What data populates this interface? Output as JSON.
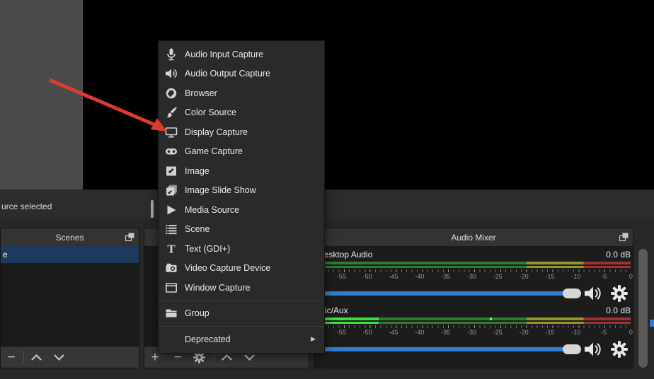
{
  "status_bar": {
    "text": "urce selected"
  },
  "menu": {
    "items": [
      {
        "label": "Audio Input Capture"
      },
      {
        "label": "Audio Output Capture"
      },
      {
        "label": "Browser"
      },
      {
        "label": "Color Source"
      },
      {
        "label": "Display Capture"
      },
      {
        "label": "Game Capture"
      },
      {
        "label": "Image"
      },
      {
        "label": "Image Slide Show"
      },
      {
        "label": "Media Source"
      },
      {
        "label": "Scene"
      },
      {
        "label": "Text (GDI+)"
      },
      {
        "label": "Video Capture Device"
      },
      {
        "label": "Window Capture"
      },
      {
        "label": "Group"
      },
      {
        "label": "Deprecated"
      }
    ],
    "submenu_arrow_glyph": "▶"
  },
  "scenes_panel": {
    "title": "Scenes",
    "selected_scene_label": "e"
  },
  "toolbar_glyphs": {
    "plus": "+",
    "minus": "−"
  },
  "audio_mixer": {
    "title": "Audio Mixer",
    "ticks": [
      "-55",
      "-50",
      "-45",
      "-40",
      "-35",
      "-30",
      "-25",
      "-20",
      "-15",
      "-10",
      "-5",
      "0"
    ],
    "channels": [
      {
        "name": "Desktop Audio",
        "volume_db": "0.0 dB",
        "level_db": -60,
        "peak_db": null
      },
      {
        "name": "Mic/Aux",
        "volume_db": "0.0 dB",
        "level_db": -48,
        "peak_db": -27
      }
    ]
  },
  "colors": {
    "accent_blue": "#2e7cd6",
    "selected_row_blue": "#1e3a5a",
    "meter_green_dim": "#2e7d2e",
    "meter_yellow_dim": "#96962e",
    "meter_red_dim": "#9e3232",
    "meter_green_active": "#3ce03c",
    "arrow_red": "#df3b2c"
  }
}
